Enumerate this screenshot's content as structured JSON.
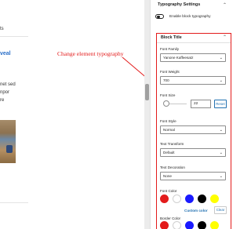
{
  "canvas": {
    "snippets": [
      "ts",
      "→",
      "veal",
      "",
      "net sed",
      "npor",
      "re"
    ],
    "annotation": "Change element typography"
  },
  "sidebar": {
    "section_title": "Typography Settings",
    "toggle_label": "Enable block typography",
    "toggle_on": false,
    "panel": {
      "title": "Block Title",
      "font_family": {
        "label": "Font Family",
        "value": "Yanone Kaffeesatz"
      },
      "font_weight": {
        "label": "Font Weight",
        "value": "700"
      },
      "font_size": {
        "label": "Font Size",
        "value": "22",
        "reset_label": "Reset"
      },
      "font_style": {
        "label": "Font Style",
        "value": "Normal"
      },
      "text_transform": {
        "label": "Text Transform",
        "value": "Default"
      },
      "text_decoration": {
        "label": "Text Decoration",
        "value": "None"
      },
      "font_color": {
        "label": "Font Color",
        "swatches": [
          "#e31b1b",
          "#ffffff",
          "#1a1aff",
          "#000000",
          "#ffff00"
        ],
        "custom_label": "Custom color",
        "clear_label": "Clear"
      },
      "border_color": {
        "label": "Border Color",
        "swatches": [
          "#e31b1b",
          "#ffffff",
          "#1a1aff",
          "#000000",
          "#ffff00"
        ]
      }
    }
  },
  "colors": {
    "accent": "#2271b1",
    "annotation": "#e31b1b"
  }
}
